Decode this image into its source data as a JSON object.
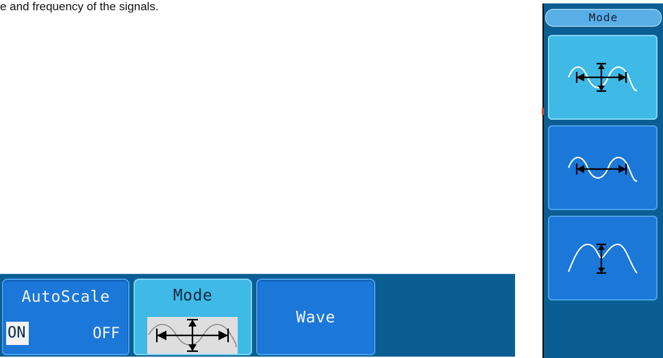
{
  "caption": {
    "text": "e and frequency of the signals."
  },
  "bottom_menu": {
    "autoscale": {
      "label": "AutoScale",
      "on_label": "ON",
      "off_label": "OFF",
      "selected": "ON"
    },
    "mode": {
      "label": "Mode",
      "preview_icon": "horizontal-vertical-measure-icon"
    },
    "wave": {
      "label": "Wave"
    }
  },
  "side_panel": {
    "title": "Mode",
    "options": [
      {
        "icon": "horizontal-vertical-measure-icon",
        "active": true
      },
      {
        "icon": "horizontal-measure-icon",
        "active": false
      },
      {
        "icon": "vertical-measure-icon",
        "active": false
      }
    ]
  },
  "colors": {
    "menu_bg": "#0a5e93",
    "button_bg": "#1b77d8",
    "button_active_bg": "#3fb9e6",
    "title_bg": "#5aaee6"
  }
}
